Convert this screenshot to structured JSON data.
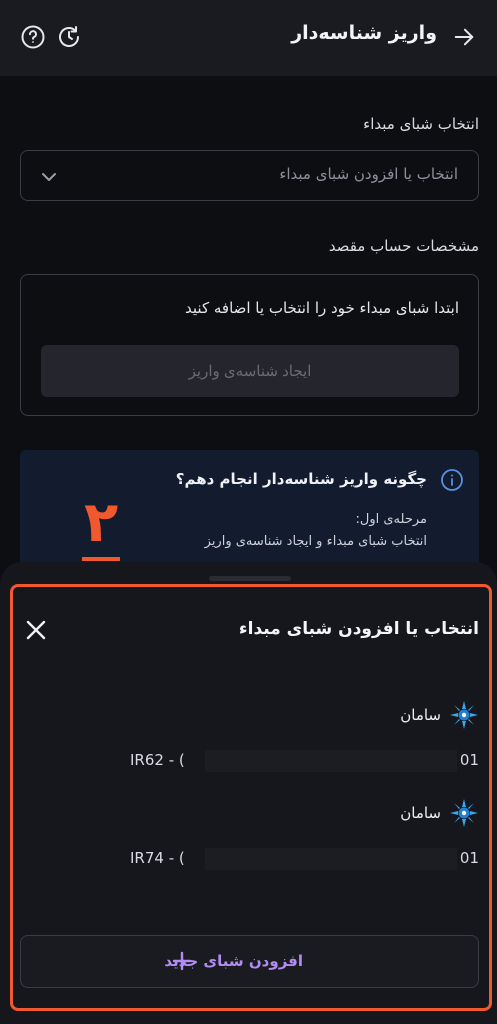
{
  "header": {
    "title": "واریز شناسه‌دار",
    "back_icon": "arrow-right-icon",
    "help_icon": "question-circle-icon",
    "history_icon": "history-clock-icon"
  },
  "source": {
    "label": "انتخاب شبای مبداء",
    "placeholder": "انتخاب یا افزودن شبای مبداء"
  },
  "destination": {
    "label": "مشخصات حساب مقصد",
    "hint": "ابتدا شبای مبداء خود را انتخاب یا اضافه کنید",
    "create_button": "ایجاد شناسه‌ی واریز"
  },
  "guide": {
    "title": "چگونه واریز شناسه‌دار انجام دهم؟",
    "step_label": "مرحله‌ی اول:",
    "step_desc": "انتخاب شبای مبداء و ایجاد شناسه‌ی واریز",
    "step_number": "۲"
  },
  "sheet": {
    "title": "انتخاب یا افزودن شبای مبداء",
    "accounts": [
      {
        "bank": "سامان",
        "iban_prefix": "IR62 - (",
        "iban_suffix": "· 01"
      },
      {
        "bank": "سامان",
        "iban_prefix": "IR74 - (",
        "iban_suffix": "· 01"
      }
    ],
    "add_button": "افزودن شبای جدید"
  },
  "colors": {
    "accent": "#b18cf3",
    "highlight": "#f0582d",
    "background": "#0d0e12"
  }
}
